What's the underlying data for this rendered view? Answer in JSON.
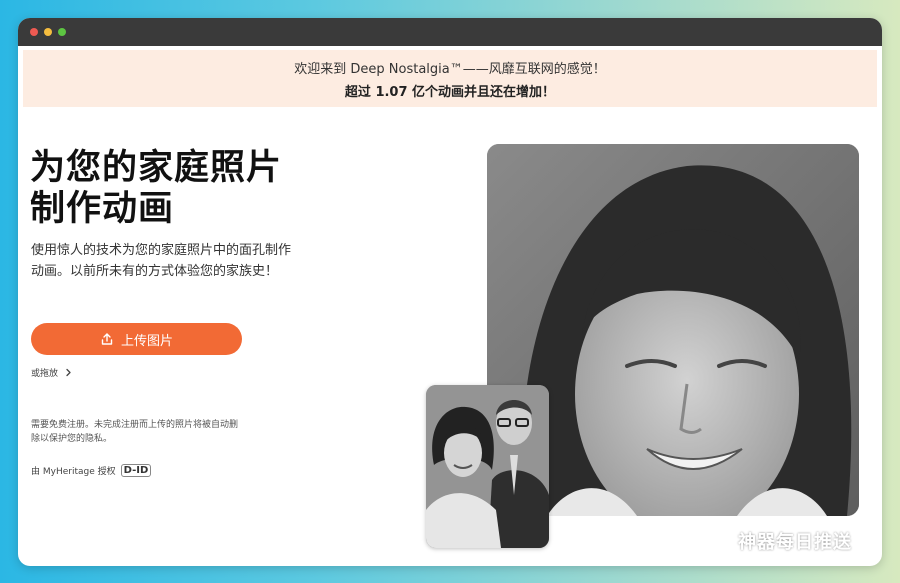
{
  "banner": {
    "line1": "欢迎来到 Deep Nostalgia™——风靡互联网的感觉！",
    "line2": "超过 1.07 亿个动画并且还在增加！"
  },
  "hero": {
    "title_line1": "为您的家庭照片",
    "title_line2": "制作动画",
    "description": "使用惊人的技术为您的家庭照片中的面孔制作动画。以前所未有的方式体验您的家族史！",
    "upload_label": "上传图片",
    "drag_label": "或拖放",
    "note": "需要免费注册。未完成注册而上传的照片将被自动删除以保护您的隐私。",
    "powered_by": "由 MyHeritage 授权",
    "partner_logo": "D-ID"
  },
  "watermark": {
    "text": "神器每日推送",
    "icon": "wechat-icon"
  },
  "colors": {
    "accent": "#f26a35",
    "banner_bg": "#fdece1",
    "titlebar": "#3a3a3a"
  }
}
